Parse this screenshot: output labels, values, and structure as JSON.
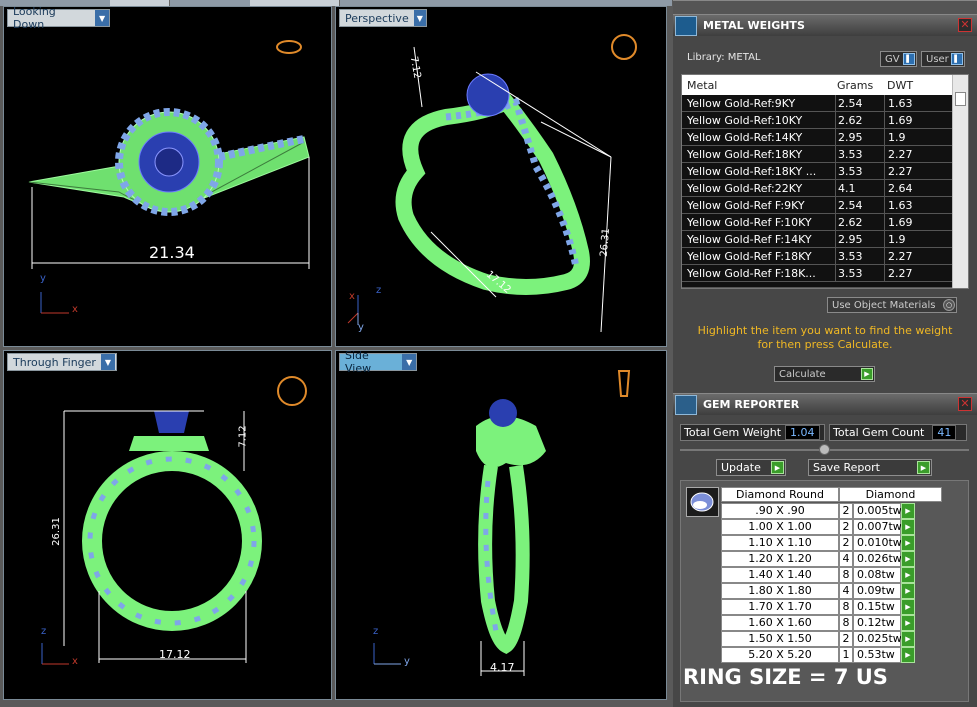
{
  "viewports": {
    "top_left": {
      "label": "Looking Down",
      "dimension": "21.34"
    },
    "top_right": {
      "label": "Perspective",
      "dim_height": "7.12",
      "dim_width": "17.12",
      "dim_depth": "26.31"
    },
    "bottom_left": {
      "label": "Through Finger",
      "dim_top": "7.12",
      "dim_height": "26.31",
      "dim_width": "17.12"
    },
    "bottom_right": {
      "label": "Side View",
      "dim_width": "4.17"
    }
  },
  "axes": {
    "x": "x",
    "y": "y",
    "z": "z"
  },
  "metal_weights": {
    "title": "METAL WEIGHTS",
    "library_label": "Library: METAL",
    "gv_label": "GV",
    "user_label": "User",
    "columns": [
      "Metal",
      "Grams",
      "DWT"
    ],
    "rows": [
      [
        "Yellow Gold-Ref:9KY",
        "2.54",
        "1.63"
      ],
      [
        "Yellow Gold-Ref:10KY",
        "2.62",
        "1.69"
      ],
      [
        "Yellow Gold-Ref:14KY",
        "2.95",
        "1.9"
      ],
      [
        "Yellow Gold-Ref:18KY",
        "3.53",
        "2.27"
      ],
      [
        "Yellow Gold-Ref:18KY ...",
        "3.53",
        "2.27"
      ],
      [
        "Yellow Gold-Ref:22KY",
        "4.1",
        "2.64"
      ],
      [
        "Yellow Gold-Ref F:9KY",
        "2.54",
        "1.63"
      ],
      [
        "Yellow Gold-Ref F:10KY",
        "2.62",
        "1.69"
      ],
      [
        "Yellow Gold-Ref F:14KY",
        "2.95",
        "1.9"
      ],
      [
        "Yellow Gold-Ref F:18KY",
        "3.53",
        "2.27"
      ],
      [
        "Yellow Gold-Ref F:18K...",
        "3.53",
        "2.27"
      ]
    ],
    "use_object_materials": "Use Object Materials",
    "hint": "Highlight the item you want to find the weight for then press Calculate.",
    "calculate_label": "Calculate"
  },
  "gem_reporter": {
    "title": "GEM REPORTER",
    "total_weight_label": "Total Gem Weight",
    "total_weight_value": "1.04",
    "total_count_label": "Total Gem Count",
    "total_count_value": "41",
    "update_label": "Update",
    "save_report_label": "Save Report",
    "col_shape": "Diamond Round",
    "col_material": "Diamond",
    "rows": [
      [
        ".90 X .90",
        "2",
        "0.005tw"
      ],
      [
        "1.00 X 1.00",
        "2",
        "0.007tw"
      ],
      [
        "1.10 X 1.10",
        "2",
        "0.010tw"
      ],
      [
        "1.20 X 1.20",
        "4",
        "0.026tw"
      ],
      [
        "1.40 X 1.40",
        "8",
        "0.08tw"
      ],
      [
        "1.80 X 1.80",
        "4",
        "0.09tw"
      ],
      [
        "1.70 X 1.70",
        "8",
        "0.15tw"
      ],
      [
        "1.60 X 1.60",
        "8",
        "0.12tw"
      ],
      [
        "1.50 X 1.50",
        "2",
        "0.025tw"
      ],
      [
        "5.20 X 5.20",
        "1",
        "0.53tw"
      ]
    ]
  },
  "ring_size": "RING SIZE = 7 US",
  "colors": {
    "metal": "#7cf27c",
    "gem": "#2a3fb0",
    "halo": "#7fa6e8",
    "hint": "#f0b824",
    "accent_green": "#3a9d2a"
  }
}
